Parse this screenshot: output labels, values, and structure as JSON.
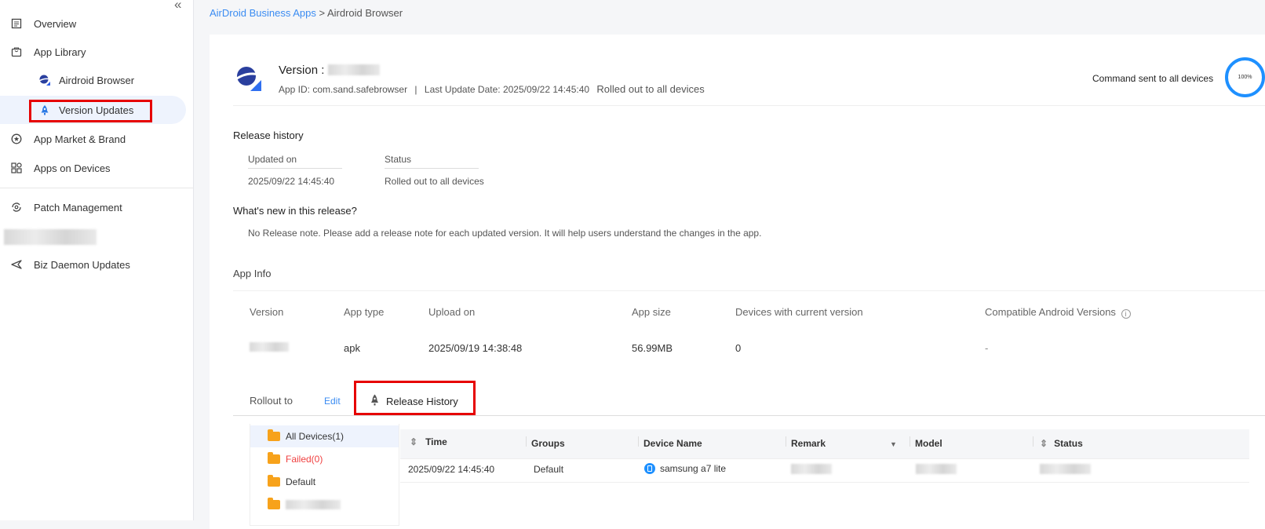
{
  "sidebar": {
    "collapse_glyph": "«",
    "items": [
      {
        "label": "Overview",
        "icon": "document-icon"
      },
      {
        "label": "App Library",
        "icon": "bag-icon"
      },
      {
        "label": "Airdroid Browser",
        "icon": "browser-logo-icon"
      },
      {
        "label": "Version Updates",
        "icon": "rocket-icon"
      },
      {
        "label": "App Market & Brand",
        "icon": "star-circle-icon"
      },
      {
        "label": "Apps on Devices",
        "icon": "apps-grid-icon"
      },
      {
        "label": "Patch Management",
        "icon": "patch-icon"
      },
      {
        "label": "Biz Daemon Updates",
        "icon": "send-icon"
      }
    ]
  },
  "breadcrumb": {
    "parent": "AirDroid Business Apps",
    "separator": " > ",
    "current": "Airdroid Browser"
  },
  "header": {
    "version_label": "Version :",
    "app_id": "App ID: com.sand.safebrowser",
    "divider": "|",
    "last_update": "Last Update Date: 2025/09/22 14:45:40",
    "rollout_status": "Rolled out to all devices",
    "command_status": "Command sent to all devices",
    "progress": "100%"
  },
  "release_history": {
    "title": "Release history",
    "columns": [
      "Updated on",
      "Status"
    ],
    "row": [
      "2025/09/22 14:45:40",
      "Rolled out to all devices"
    ]
  },
  "whats_new": {
    "title": "What's new in this release?",
    "note": "No Release note. Please add a release note for each updated version. It will help users understand the changes in the app."
  },
  "app_info": {
    "title": "App Info",
    "columns": [
      "Version",
      "App type",
      "Upload on",
      "App size",
      "Devices with current version",
      "Compatible Android Versions"
    ],
    "row": [
      "",
      "apk",
      "2025/09/19 14:38:48",
      "56.99MB",
      "0",
      "-"
    ]
  },
  "tabs": {
    "rollout": "Rollout to",
    "edit": "Edit",
    "release_history": "Release History"
  },
  "tree": {
    "items": [
      "All Devices(1)",
      "Failed(0)",
      "Default"
    ]
  },
  "table": {
    "columns": [
      "Time",
      "Groups",
      "Device Name",
      "Remark",
      "Model",
      "Status"
    ],
    "rows": [
      {
        "time": "2025/09/22 14:45:40",
        "group": "Default",
        "device": "samsung a7 lite"
      }
    ]
  },
  "colors": {
    "accent": "#1e90ff",
    "link": "#3b8cf2",
    "highlight": "#e60000",
    "failed": "#f04040",
    "folder": "#f7a21b"
  }
}
